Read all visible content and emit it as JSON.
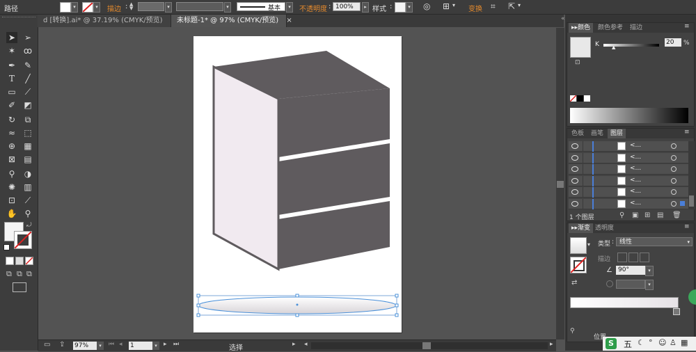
{
  "control_bar": {
    "object_type": "路径",
    "stroke_label": "描边",
    "stroke_value": "",
    "brush_label": "基本",
    "opacity_label": "不透明度",
    "opacity_value": "100%",
    "style_label": "样式",
    "transform_label": "变换"
  },
  "tabs": [
    {
      "label": "d [转换].ai* @ 37.19% (CMYK/预览)"
    },
    {
      "label": "未标题-1* @ 97% (CMYK/预览)"
    }
  ],
  "toolbar": {
    "tools": [
      "selection-tool",
      "direct-selection-tool",
      "magic-wand-tool",
      "lasso-tool",
      "pen-tool",
      "curvature-tool",
      "type-tool",
      "line-tool",
      "rectangle-tool",
      "paintbrush-tool",
      "pencil-tool",
      "eraser-tool",
      "rotate-tool",
      "scale-tool",
      "width-tool",
      "free-transform-tool",
      "shape-builder-tool",
      "perspective-grid-tool",
      "mesh-tool",
      "gradient-tool",
      "eyedropper-tool",
      "blend-tool",
      "symbol-sprayer-tool",
      "column-graph-tool",
      "artboard-tool",
      "slice-tool",
      "hand-tool",
      "zoom-tool"
    ]
  },
  "status_bar": {
    "zoom": "97%",
    "page": "1",
    "mode": "选择"
  },
  "color_panel": {
    "tabs": [
      "颜色",
      "颜色参考",
      "描边"
    ],
    "channel": "K",
    "value": "20",
    "unit": "%"
  },
  "layers_panel": {
    "tabs": [
      "色板",
      "画笔",
      "图层"
    ],
    "rows": [
      {
        "name": "<..."
      },
      {
        "name": "<..."
      },
      {
        "name": "<..."
      },
      {
        "name": "<..."
      },
      {
        "name": "<..."
      },
      {
        "name": "<..."
      }
    ],
    "footer": "1 个图层"
  },
  "gradient_panel": {
    "tabs": [
      "渐变",
      "透明度"
    ],
    "type_label": "类型",
    "type_value": "线性",
    "stroke_label": "描边",
    "angle_value": "90°",
    "position_label": "位置"
  },
  "colors": {
    "cabinet_gray": "#5f5b5e",
    "cabinet_side": "#f1eaf0",
    "selection_blue": "#4a90d9"
  }
}
